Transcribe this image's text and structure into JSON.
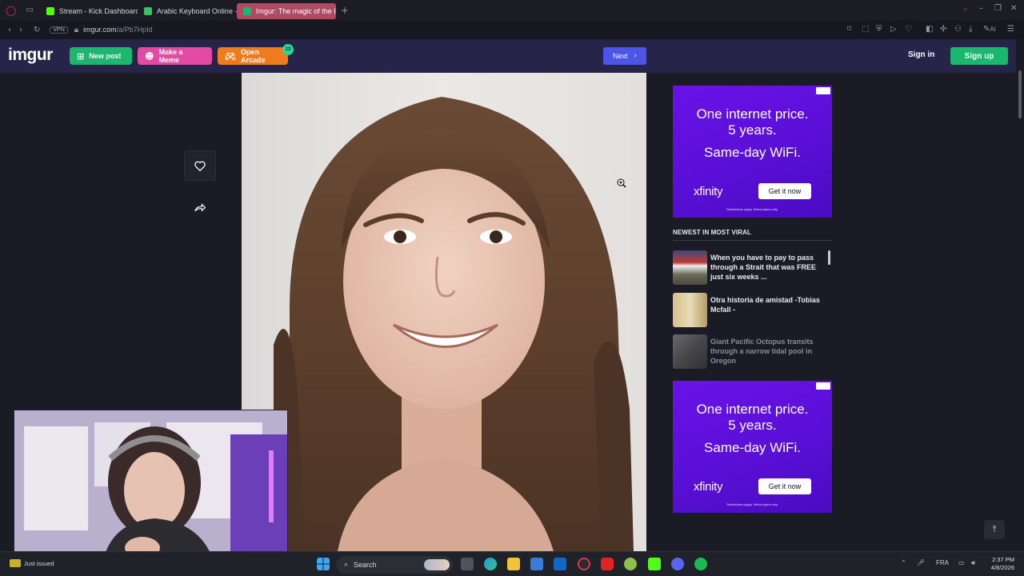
{
  "browser": {
    "tabs": [
      {
        "label": "Stream - Kick Dashboard",
        "color": "#53fc18",
        "active": false
      },
      {
        "label": "Arabic Keyboard Online -",
        "color": "#3fbf5f",
        "active": false
      },
      {
        "label": "Imgur: The magic of the In",
        "color": "#1bb76e",
        "active": true
      }
    ],
    "new_tab": "+",
    "vpn_label": "VPN",
    "url_host": "imgur.com",
    "url_path": "/a/Pb7HpId",
    "ai_label": "AI"
  },
  "header": {
    "logo": "imgur",
    "new_post": "New post",
    "make_meme": "Make a Meme",
    "open_arcade": "Open Arcade",
    "arcade_badge": "13",
    "next": "Next",
    "sign_in": "Sign in",
    "sign_up": "Sign up",
    "colors": {
      "nav_bg": "#27244a",
      "new_post": "#1bb76e",
      "meme": "#e24aa3",
      "arcade": "#f07b1d",
      "next": "#4d55e8"
    }
  },
  "ads": [
    {
      "line1": "One internet price.",
      "line2": "5 years.",
      "line3": "Same-day WiFi.",
      "brand": "xfinity",
      "cta": "Get it now",
      "fine": "Restrictions apply. Select plans only."
    },
    {
      "line1": "One internet price.",
      "line2": "5 years.",
      "line3": "Same-day WiFi.",
      "brand": "xfinity",
      "cta": "Get it now",
      "fine": "Restrictions apply. Select plans only."
    }
  ],
  "viral": {
    "title": "NEWEST IN MOST VIRAL",
    "items": [
      {
        "title": "When you have to pay to pass through a Strait that was FREE just six weeks ..."
      },
      {
        "title": "Otra historia de amistad -Tobias Mcfall -"
      },
      {
        "title": "Giant Pacific Octopus transits through a narrow tidal pool in Oregon"
      }
    ]
  },
  "taskbar": {
    "notification": "Just issued",
    "search": "Search",
    "lang": "FRA",
    "time": "2:37 PM",
    "date": "4/8/2026"
  }
}
